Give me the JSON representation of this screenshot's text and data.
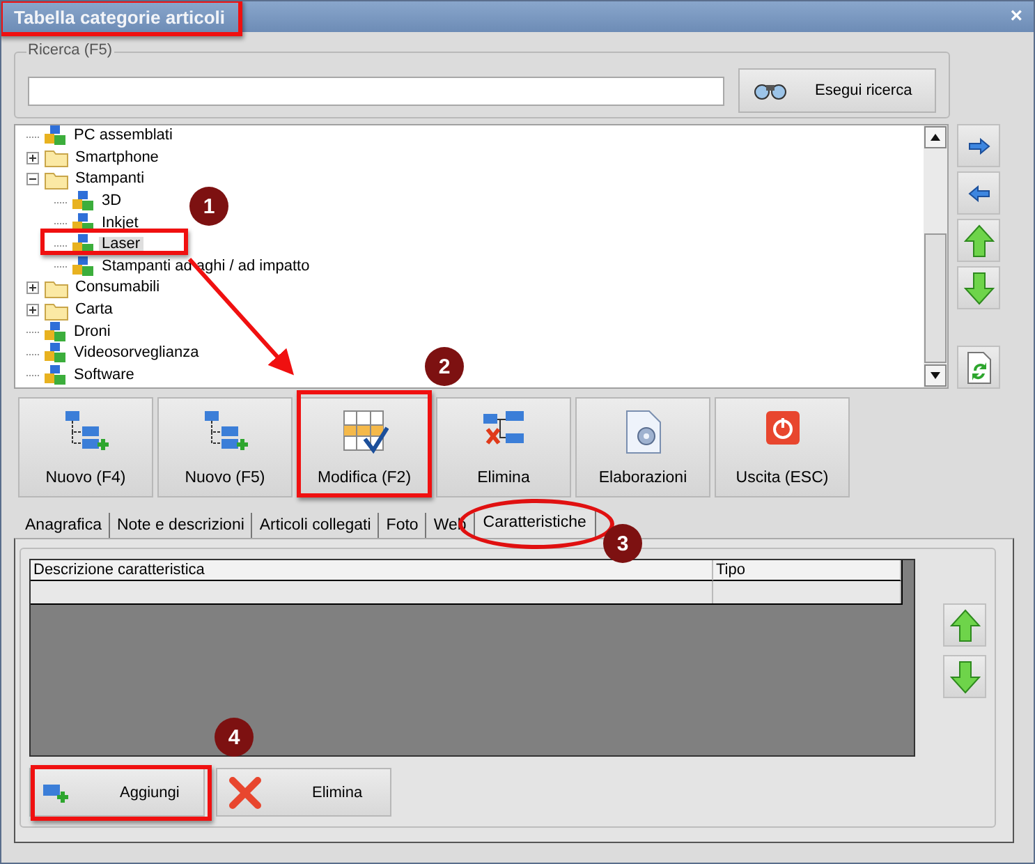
{
  "window": {
    "title": "Tabella categorie articoli",
    "close": "×"
  },
  "search": {
    "label": "Ricerca (F5)",
    "button": "Esegui ricerca"
  },
  "tree": [
    {
      "label": "PC assemblati",
      "kind": "category",
      "selected": false
    },
    {
      "label": "Smartphone",
      "kind": "folder",
      "expanded": false,
      "selected": false
    },
    {
      "label": "Stampanti",
      "kind": "folder",
      "expanded": true,
      "selected": false,
      "children": [
        {
          "label": "3D",
          "kind": "category",
          "selected": false
        },
        {
          "label": "Inkjet",
          "kind": "category",
          "selected": false
        },
        {
          "label": "Laser",
          "kind": "category",
          "selected": true
        },
        {
          "label": "Stampanti ad aghi / ad impatto",
          "kind": "category",
          "selected": false
        }
      ]
    },
    {
      "label": "Consumabili",
      "kind": "folder",
      "expanded": false,
      "selected": false
    },
    {
      "label": "Carta",
      "kind": "folder",
      "expanded": false,
      "selected": false
    },
    {
      "label": "Droni",
      "kind": "category",
      "selected": false
    },
    {
      "label": "Videosorveglianza",
      "kind": "category",
      "selected": false
    },
    {
      "label": "Software",
      "kind": "category",
      "selected": false
    }
  ],
  "toolbar": [
    {
      "label": "Nuovo (F4)",
      "kind": "new-sibling"
    },
    {
      "label": "Nuovo (F5)",
      "kind": "new-child"
    },
    {
      "label": "Modifica (F2)",
      "kind": "edit"
    },
    {
      "label": "Elimina",
      "kind": "delete"
    },
    {
      "label": "Elaborazioni",
      "kind": "process"
    },
    {
      "label": "Uscita (ESC)",
      "kind": "exit"
    }
  ],
  "tabs": [
    {
      "label": "Anagrafica",
      "selected": false
    },
    {
      "label": "Note e descrizioni",
      "selected": false
    },
    {
      "label": "Articoli collegati",
      "selected": false
    },
    {
      "label": "Foto",
      "selected": false
    },
    {
      "label": "Web",
      "selected": false
    },
    {
      "label": "Caratteristiche",
      "selected": true
    }
  ],
  "table": {
    "columns": [
      "Descrizione caratteristica",
      "Tipo"
    ]
  },
  "panel_buttons": [
    {
      "label": "Aggiungi",
      "kind": "add"
    },
    {
      "label": "Elimina",
      "kind": "remove"
    }
  ],
  "callouts": [
    {
      "number": "1"
    },
    {
      "number": "2"
    },
    {
      "number": "3"
    },
    {
      "number": "4"
    }
  ]
}
